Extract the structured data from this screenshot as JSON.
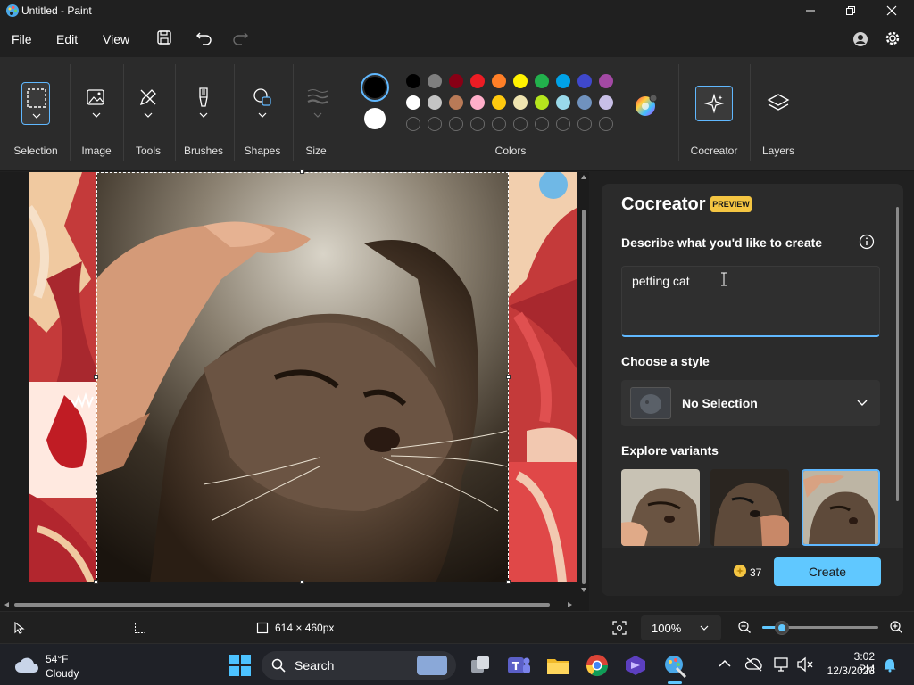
{
  "window": {
    "title": "Untitled - Paint",
    "app_icon": "paint-palette-icon"
  },
  "menu": {
    "file": "File",
    "edit": "Edit",
    "view": "View"
  },
  "ribbon": {
    "selection_label": "Selection",
    "image_label": "Image",
    "tools_label": "Tools",
    "brushes_label": "Brushes",
    "shapes_label": "Shapes",
    "size_label": "Size",
    "colors_label": "Colors",
    "cocreator_label": "Cocreator",
    "layers_label": "Layers",
    "primary_color": "#000000",
    "secondary_color": "#ffffff",
    "palette_row1": [
      "#000000",
      "#7f7f7f",
      "#880015",
      "#ed1c24",
      "#ff7f27",
      "#fff200",
      "#22b14c",
      "#00a2e8",
      "#3f48cc",
      "#a349a4"
    ],
    "palette_row2": [
      "#ffffff",
      "#c3c3c3",
      "#b97a57",
      "#ffaec9",
      "#ffc90e",
      "#efe4b0",
      "#b5e61d",
      "#99d9ea",
      "#7092be",
      "#c8bfe7"
    ]
  },
  "panel": {
    "title": "Cocreator",
    "badge": "PREVIEW",
    "describe_label": "Describe what you'd like to create",
    "prompt_value": "petting cat",
    "style_label": "Choose a style",
    "style_value": "No Selection",
    "variants_label": "Explore variants",
    "credits": "37",
    "create_label": "Create"
  },
  "status": {
    "canvas_size": "614 × 460px",
    "zoom": "100%",
    "zoom_level": 0.12
  },
  "taskbar": {
    "temperature": "54°F",
    "weather": "Cloudy",
    "search_label": "Search",
    "time": "3:02 PM",
    "date": "12/3/2023"
  },
  "colors": {
    "accent": "#60c8ff",
    "badge": "#f4c542"
  }
}
